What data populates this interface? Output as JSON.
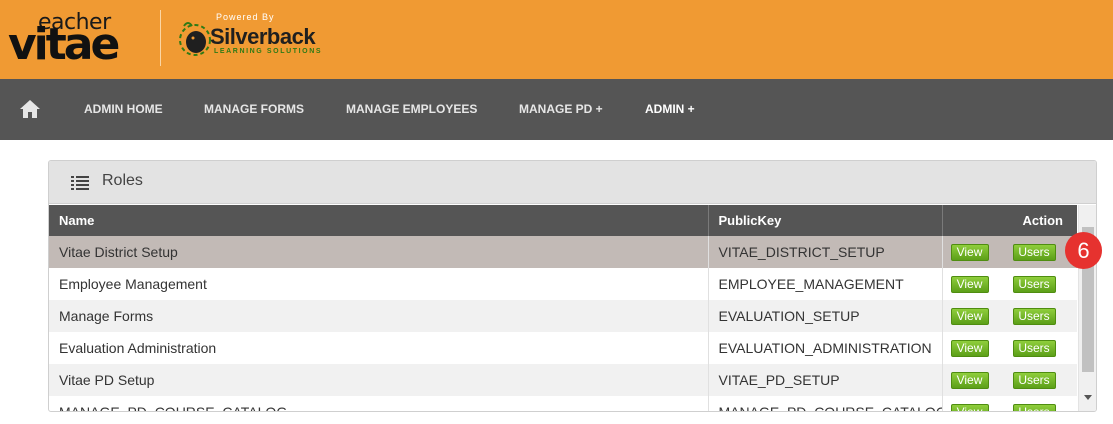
{
  "header": {
    "logo_small": "eacher",
    "logo_big": "vitae",
    "powered_by": "Powered By",
    "partner_name": "Silverback",
    "partner_tagline": "LEARNING SOLUTIONS"
  },
  "nav": {
    "home_icon": "home-icon",
    "items": [
      {
        "label": "ADMIN HOME"
      },
      {
        "label": "MANAGE FORMS"
      },
      {
        "label": "MANAGE EMPLOYEES"
      },
      {
        "label": "MANAGE PD +"
      },
      {
        "label": "ADMIN +"
      }
    ]
  },
  "panel": {
    "title": "Roles",
    "icon": "list-icon"
  },
  "table": {
    "columns": [
      "Name",
      "PublicKey",
      "Action"
    ],
    "rows": [
      {
        "name": "Vitae District Setup",
        "key": "VITAE_DISTRICT_SETUP",
        "view": "View",
        "users": "Users"
      },
      {
        "name": "Employee Management",
        "key": "EMPLOYEE_MANAGEMENT",
        "view": "View",
        "users": "Users"
      },
      {
        "name": "Manage Forms",
        "key": "EVALUATION_SETUP",
        "view": "View",
        "users": "Users"
      },
      {
        "name": "Evaluation Administration",
        "key": "EVALUATION_ADMINISTRATION",
        "view": "View",
        "users": "Users"
      },
      {
        "name": "Vitae PD Setup",
        "key": "VITAE_PD_SETUP",
        "view": "View",
        "users": "Users"
      },
      {
        "name": "MANAGE_PD_COURSE_CATALOG",
        "key": "MANAGE_PD_COURSE_CATALOG",
        "view": "View",
        "users": "Users"
      }
    ]
  },
  "badge": "6",
  "colors": {
    "header_bg": "#f09a33",
    "nav_bg": "#555555",
    "button_green": "#6aab1f",
    "badge_red": "#e6322f",
    "selected_row": "#c2bab6"
  }
}
